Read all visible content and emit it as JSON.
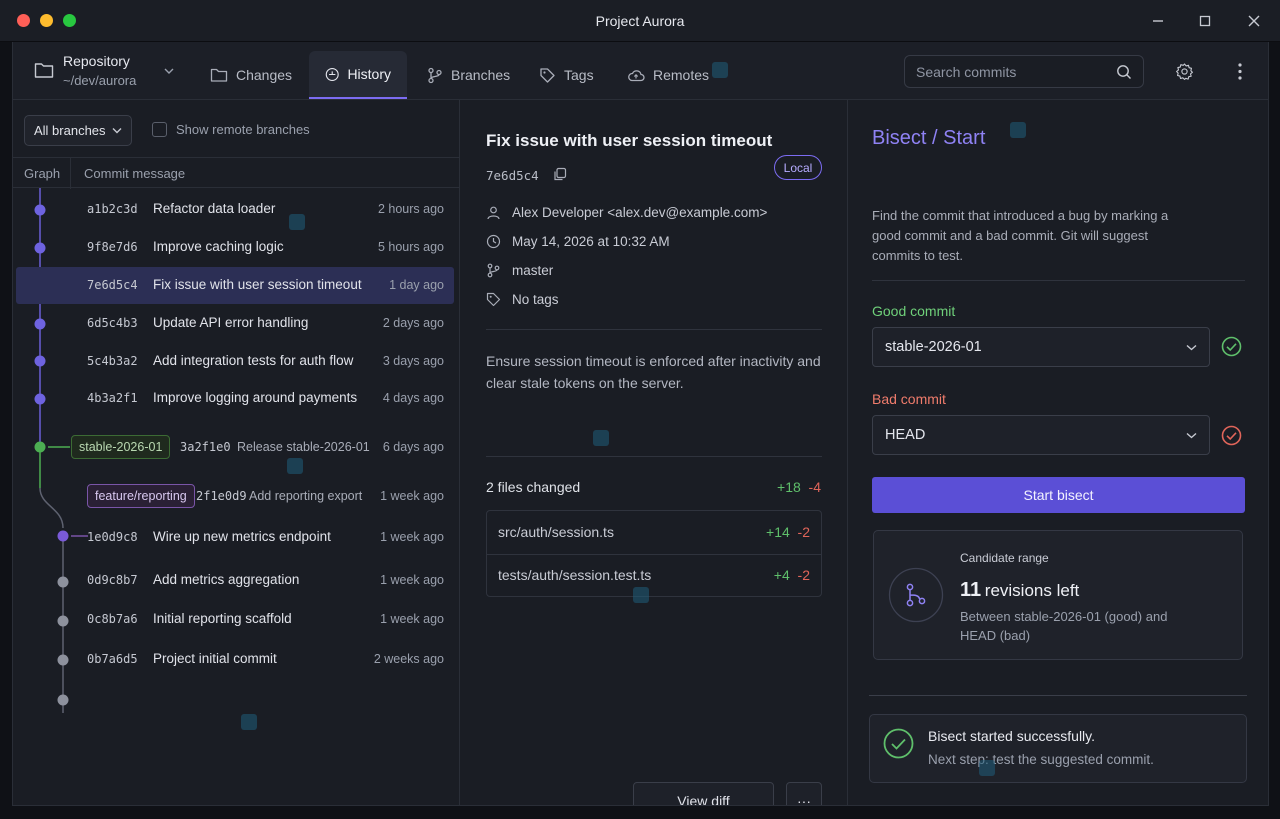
{
  "window": {
    "title": "Project Aurora"
  },
  "repo": {
    "label": "Repository",
    "path": "~/dev/aurora"
  },
  "tabs": [
    {
      "label": "Changes",
      "icon": "folder-icon"
    },
    {
      "label": "History",
      "icon": "history-icon"
    },
    {
      "label": "Branches",
      "icon": "branch-icon"
    },
    {
      "label": "Tags",
      "icon": "tag-icon"
    },
    {
      "label": "Remotes",
      "icon": "cloud-icon"
    }
  ],
  "search": {
    "placeholder": "Search commits"
  },
  "history": {
    "branch_filter": "All branches",
    "show_remote_label": "Show remote branches",
    "col_graph": "Graph",
    "col_message": "Commit message",
    "commits": [
      {
        "hash": "a1b2c3d",
        "message": "Refactor data loader",
        "time": "2 hours ago"
      },
      {
        "hash": "9f8e7d6",
        "message": "Improve caching logic",
        "time": "5 hours ago"
      },
      {
        "hash": "7e6d5c4",
        "message": "Fix issue with user session timeout",
        "time": "1 day ago"
      },
      {
        "hash": "6d5c4b3",
        "message": "Update API error handling",
        "time": "2 days ago"
      },
      {
        "hash": "5c4b3a2",
        "message": "Add integration tests for auth flow",
        "time": "3 days ago"
      },
      {
        "hash": "4b3a2f1",
        "message": "Improve logging around payments",
        "time": "4 days ago"
      },
      {
        "badge": "stable-2026-01",
        "hash": "3a2f1e0",
        "message": "Release stable-2026-01",
        "time": "6 days ago"
      },
      {
        "badge": "feature/reporting",
        "hash": "2f1e0d9",
        "message": "Add reporting export",
        "time": "1 week ago"
      },
      {
        "hash": "1e0d9c8",
        "message": "Wire up new metrics endpoint",
        "time": "1 week ago"
      },
      {
        "hash": "0d9c8b7",
        "message": "Add metrics aggregation",
        "time": "1 week ago"
      },
      {
        "hash": "0c8b7a6",
        "message": "Initial reporting scaffold",
        "time": "1 week ago"
      },
      {
        "hash": "0b7a6d5",
        "message": "Project initial commit",
        "time": "2 weeks ago"
      }
    ]
  },
  "detail": {
    "title": "Fix issue with user session timeout",
    "hash": "7e6d5c4",
    "scope": "Local",
    "author": "Alex Developer <alex.dev@example.com>",
    "date": "May 14, 2026 at 10:32 AM",
    "branch": "master",
    "tags": "No tags",
    "description": "Ensure session timeout is enforced after inactivity and clear stale tokens on the server.",
    "files_changed": "2 files changed",
    "total_add": "+18",
    "total_del": "-4",
    "files": [
      {
        "name": "src/auth/session.ts",
        "add": "+14",
        "del": "-2"
      },
      {
        "name": "tests/auth/session.test.ts",
        "add": "+4",
        "del": "-2"
      }
    ],
    "view_diff": "View diff",
    "more": "···"
  },
  "bisect": {
    "title": "Bisect / Start",
    "description": "Find the commit that introduced a bug by marking a good commit and a bad commit. Git will suggest commits to test.",
    "good_label": "Good commit",
    "good_value": "stable-2026-01",
    "bad_label": "Bad commit",
    "bad_value": "HEAD",
    "start_button": "Start bisect",
    "range_label": "Candidate range",
    "revisions_count": "11",
    "revisions_suffix": "revisions left",
    "range_detail": "Between stable-2026-01 (good) and HEAD (bad)",
    "toast_title": "Bisect started successfully.",
    "toast_body": "Next step: test the suggested commit."
  },
  "colors": {
    "accent": "#7c6cf2",
    "good": "#5fbf6b",
    "bad": "#e0655a",
    "primary_button": "#5b4fd6"
  }
}
